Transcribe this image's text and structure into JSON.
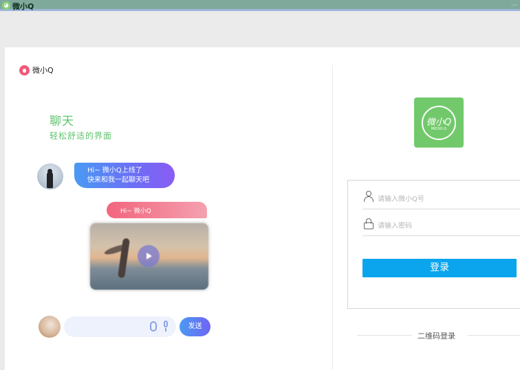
{
  "window": {
    "title": "微小Q",
    "controls": "…"
  },
  "brand": {
    "name": "微小Q"
  },
  "hero": {
    "title": "聊天",
    "subtitle": "轻松舒适的界面"
  },
  "chat": {
    "bubble_left_line1": "Hi~ 微小Q上线了",
    "bubble_left_line2": "快来和我一起聊天吧",
    "bubble_right": "Hi~ 微小Q",
    "send_label": "发送"
  },
  "logo": {
    "text": "微小Q",
    "subtext": "MICRO Q"
  },
  "login": {
    "username_placeholder": "请输入微小Q号",
    "password_placeholder": "请输入密码",
    "submit_label": "登录",
    "qr_login_label": "二维码登录"
  },
  "colors": {
    "accent_green": "#5fc36d",
    "login_button": "#0aa5ed",
    "titlebar": "#7fa99b"
  }
}
